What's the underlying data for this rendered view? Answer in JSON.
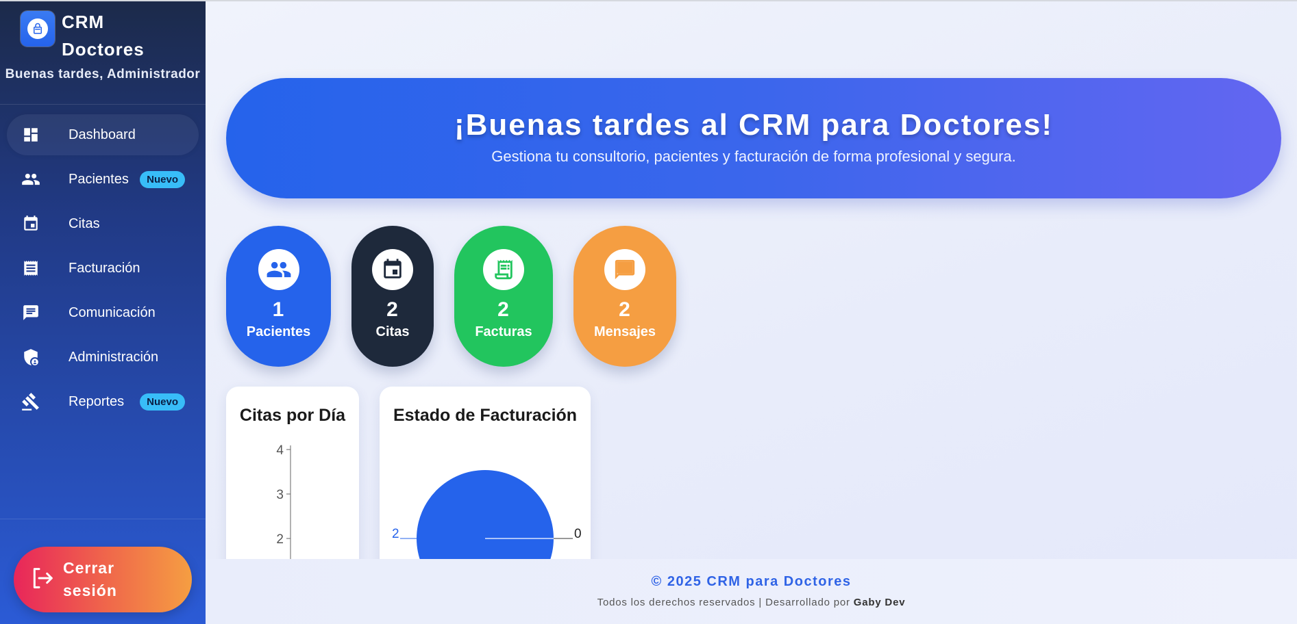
{
  "brand": {
    "title": "CRM Doctores",
    "greeting": "Buenas tardes, Administrador"
  },
  "nav": [
    {
      "label": "Dashboard",
      "icon": "dashboard-icon",
      "active": true,
      "badge": ""
    },
    {
      "label": "Pacientes",
      "icon": "people-icon",
      "active": false,
      "badge": "Nuevo"
    },
    {
      "label": "Citas",
      "icon": "calendar-icon",
      "active": false,
      "badge": ""
    },
    {
      "label": "Facturación",
      "icon": "receipt-icon",
      "active": false,
      "badge": ""
    },
    {
      "label": "Comunicación",
      "icon": "chat-icon",
      "active": false,
      "badge": ""
    },
    {
      "label": "Administración",
      "icon": "admin-shield-icon",
      "active": false,
      "badge": ""
    },
    {
      "label": "Reportes",
      "icon": "gavel-icon",
      "active": false,
      "badge": "Nuevo"
    }
  ],
  "logout": {
    "label": "Cerrar sesión",
    "icon": "logout-icon"
  },
  "hero": {
    "title": "¡Buenas tardes al CRM para Doctores!",
    "subtitle": "Gestiona tu consultorio, pacientes y facturación de forma profesional y segura."
  },
  "stats": [
    {
      "value": "1",
      "label": "Pacientes",
      "icon": "people-icon",
      "color": "#2563eb"
    },
    {
      "value": "2",
      "label": "Citas",
      "icon": "calendar-icon",
      "color": "#1e293b"
    },
    {
      "value": "2",
      "label": "Facturas",
      "icon": "receipt-icon",
      "color": "#22c55e"
    },
    {
      "value": "2",
      "label": "Mensajes",
      "icon": "chat-icon",
      "color": "#f59e42"
    }
  ],
  "chart_data": [
    {
      "type": "bar",
      "title": "Citas por Día",
      "yticks": [
        "4",
        "3",
        "2"
      ],
      "visible_ylim": [
        2,
        4
      ],
      "categories": [],
      "values": []
    },
    {
      "type": "pie",
      "title": "Estado de Facturación",
      "labels": [
        "2",
        "0"
      ],
      "values": [
        2,
        0
      ],
      "colors": [
        "#2563eb",
        "#222222"
      ]
    }
  ],
  "footer": {
    "copyright": "© 2025 CRM para Doctores",
    "rights_prefix": "Todos los derechos reservados | Desarrollado por",
    "author": "Gaby Dev"
  },
  "colors": {
    "accent": "#2563eb",
    "badge": "#38bdf8"
  }
}
